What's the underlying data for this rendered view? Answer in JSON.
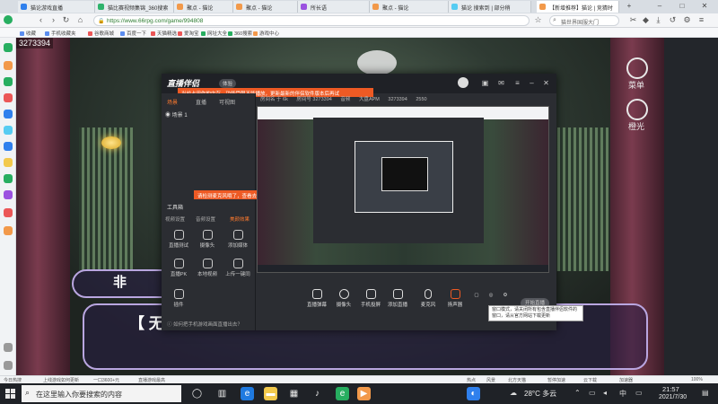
{
  "browser": {
    "tabs": [
      {
        "label": "猫论游戏直播 ",
        "active": false
      },
      {
        "label": "猫比赛视频集锦_360搜索",
        "active": false
      },
      {
        "label": "聚点 - 猫论",
        "active": false
      },
      {
        "label": "聚点 - 猫论",
        "active": false
      },
      {
        "label": "所长语",
        "active": false
      },
      {
        "label": "聚点 - 猫论",
        "active": false
      },
      {
        "label": "猫论 搜索到 | 部分稍",
        "active": false
      },
      {
        "label": "【新增推荐】猫论 | 竞猜时",
        "active": true
      }
    ],
    "url": "https://www.66rpg.com/game/994808",
    "search_placeholder": "猫世界国服大门",
    "bookmarks": [
      "收藏",
      "手机收藏夹",
      "谷歌商城",
      "百度一下",
      "天猫精选",
      "爱淘宝",
      "网址大全",
      "360搜索",
      "游戏中心"
    ]
  },
  "scene": {
    "room_id": "3273394",
    "caption_top": "非",
    "caption_main": "【 无",
    "menu_label": "菜单",
    "light_label": "橙光"
  },
  "app": {
    "logo": "直播伴侣",
    "version": "体验",
    "notice": "当前占用你的内存，功能受限不能播放，更新最新的伴侣软件版本后再试",
    "left_tabs": [
      "场景",
      "直播",
      "可视图"
    ],
    "active_left_tab": "场景",
    "scene_item": "场景 1",
    "tooltip": "请检测麦克风哦了，查看去试试吧～",
    "toolbox_title": "工具箱",
    "source_tabs": [
      "视频设置",
      "音频设置",
      "美颜效果"
    ],
    "active_source_tab": "美颜效果",
    "tools": [
      "直播测试",
      "摄像头",
      "添加媒体",
      "直播PK",
      "本地视频",
      "上传一键同",
      "插件"
    ],
    "footer": "如何把手机游戏画面直播出去？",
    "stats": [
      "房间名 于 6k",
      "房间号 3273394",
      "音频",
      "大盘APM",
      "3273394",
      "2550"
    ],
    "bottom_tools": [
      "直播弹幕",
      "摄像头",
      "手机投屏",
      "添加直播",
      "麦克风",
      "扬声器"
    ],
    "start_live": "开始直播",
    "hint": "窗口模式，请关闭所有包含直播伴侣软件的窗口，请从官方网站下载更新"
  },
  "statusbar": {
    "left": "今日热搜",
    "items": [
      "上线游戏如何更新",
      "一口3600+元",
      "直播游戏最高",
      "热点",
      "风景",
      "北方天猫",
      "暂停加速",
      "云下载",
      "加速器",
      "100%"
    ]
  },
  "taskbar": {
    "search_placeholder": "在这里输入你要搜索的内容",
    "weather": "28°C 多云",
    "time": "21:57",
    "date": "2021/7/30"
  },
  "colors": {
    "accent_orange": "#ee5a24",
    "app_bg": "#2b2d32",
    "taskbar_bg": "#1f2227"
  }
}
